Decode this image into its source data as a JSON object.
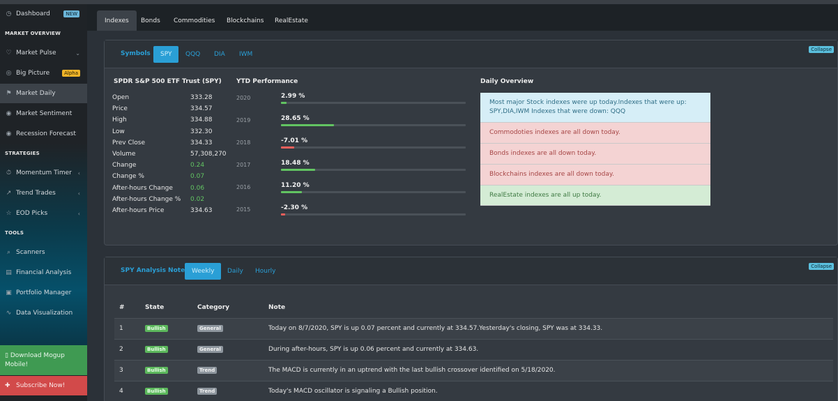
{
  "sidebar": {
    "dashboard": {
      "label": "Dashboard",
      "badge": "NEW"
    },
    "sections": {
      "market_overview": "MARKET OVERVIEW",
      "strategies": "STRATEGIES",
      "tools": "TOOLS"
    },
    "items": {
      "market_pulse": "Market Pulse",
      "big_picture": "Big Picture",
      "big_picture_badge": "Alpha",
      "market_daily": "Market Daily",
      "market_sentiment": "Market Sentiment",
      "recession_forecast": "Recession Forecast",
      "momentum_timer": "Momentum Timer",
      "trend_trades": "Trend Trades",
      "eod_picks": "EOD Picks",
      "scanners": "Scanners",
      "financial_analysis": "Financial Analysis",
      "portfolio_manager": "Portfolio Manager",
      "data_visualization": "Data Visualization"
    },
    "download": "Download Mogup Mobile!",
    "subscribe": "Subscribe Now!"
  },
  "top_tabs": [
    "Indexes",
    "Bonds",
    "Commodities",
    "Blockchains",
    "RealEstate"
  ],
  "symbols_panel": {
    "label": "Symbols",
    "tabs": [
      "SPY",
      "QQQ",
      "DIA",
      "IWM"
    ],
    "collapse": "Collapse",
    "quote_title": "SPDR S&P 500 ETF Trust (SPY)",
    "quote": [
      {
        "k": "Open",
        "v": "333.28"
      },
      {
        "k": "Price",
        "v": "334.57"
      },
      {
        "k": "High",
        "v": "334.88"
      },
      {
        "k": "Low",
        "v": "332.30"
      },
      {
        "k": "Prev Close",
        "v": "334.33"
      },
      {
        "k": "Volume",
        "v": "57,308,270"
      },
      {
        "k": "Change",
        "v": "0.24"
      },
      {
        "k": "Change %",
        "v": "0.07"
      },
      {
        "k": "After-hours Change",
        "v": "0.06"
      },
      {
        "k": "After-hours Change %",
        "v": "0.02"
      },
      {
        "k": "After-hours Price",
        "v": "334.63"
      }
    ],
    "ytd_title": "YTD Performance",
    "ytd": [
      {
        "year": "2020",
        "value": "2.99 %",
        "pct": 2.99,
        "color": "#62c462"
      },
      {
        "year": "2019",
        "value": "28.65 %",
        "pct": 28.65,
        "color": "#62c462"
      },
      {
        "year": "2018",
        "value": "-7.01 %",
        "pct": 7.01,
        "color": "#ee5f5b"
      },
      {
        "year": "2017",
        "value": "18.48 %",
        "pct": 18.48,
        "color": "#62c462"
      },
      {
        "year": "2016",
        "value": "11.20 %",
        "pct": 11.2,
        "color": "#62c462"
      },
      {
        "year": "2015",
        "value": "-2.30 %",
        "pct": 2.3,
        "color": "#ee5f5b"
      }
    ],
    "overview_title": "Daily Overview",
    "overview": [
      "Most major Stock indexes were up today.Indexes that were up: SPY,DIA,IWM Indexes that were down: QQQ",
      "Commodoties indexes are all down today.",
      "Bonds indexes are all down today.",
      "Blockchains indexes are all down today.",
      "RealEstate indexes are all up today."
    ]
  },
  "notes_panel": {
    "label": "SPY Analysis Notes",
    "tabs": [
      "Weekly",
      "Daily",
      "Hourly"
    ],
    "collapse": "Collapse",
    "headers": [
      "#",
      "State",
      "Category",
      "Note"
    ],
    "rows": [
      {
        "n": "1",
        "state": "Bullish",
        "category": "General",
        "note": "Today on 8/7/2020, SPY is up 0.07 percent and currently at 334.57.Yesterday's closing, SPY was at 334.33."
      },
      {
        "n": "2",
        "state": "Bullish",
        "category": "General",
        "note": "During after-hours, SPY is up 0.06 percent and currently at 334.63."
      },
      {
        "n": "3",
        "state": "Bullish",
        "category": "Trend",
        "note": "The MACD is currently in an uptrend with the last bullish crossover identified on 5/18/2020."
      },
      {
        "n": "4",
        "state": "Bullish",
        "category": "Trend",
        "note": "Today's MACD oscillator is signaling a Bullish position."
      }
    ]
  }
}
